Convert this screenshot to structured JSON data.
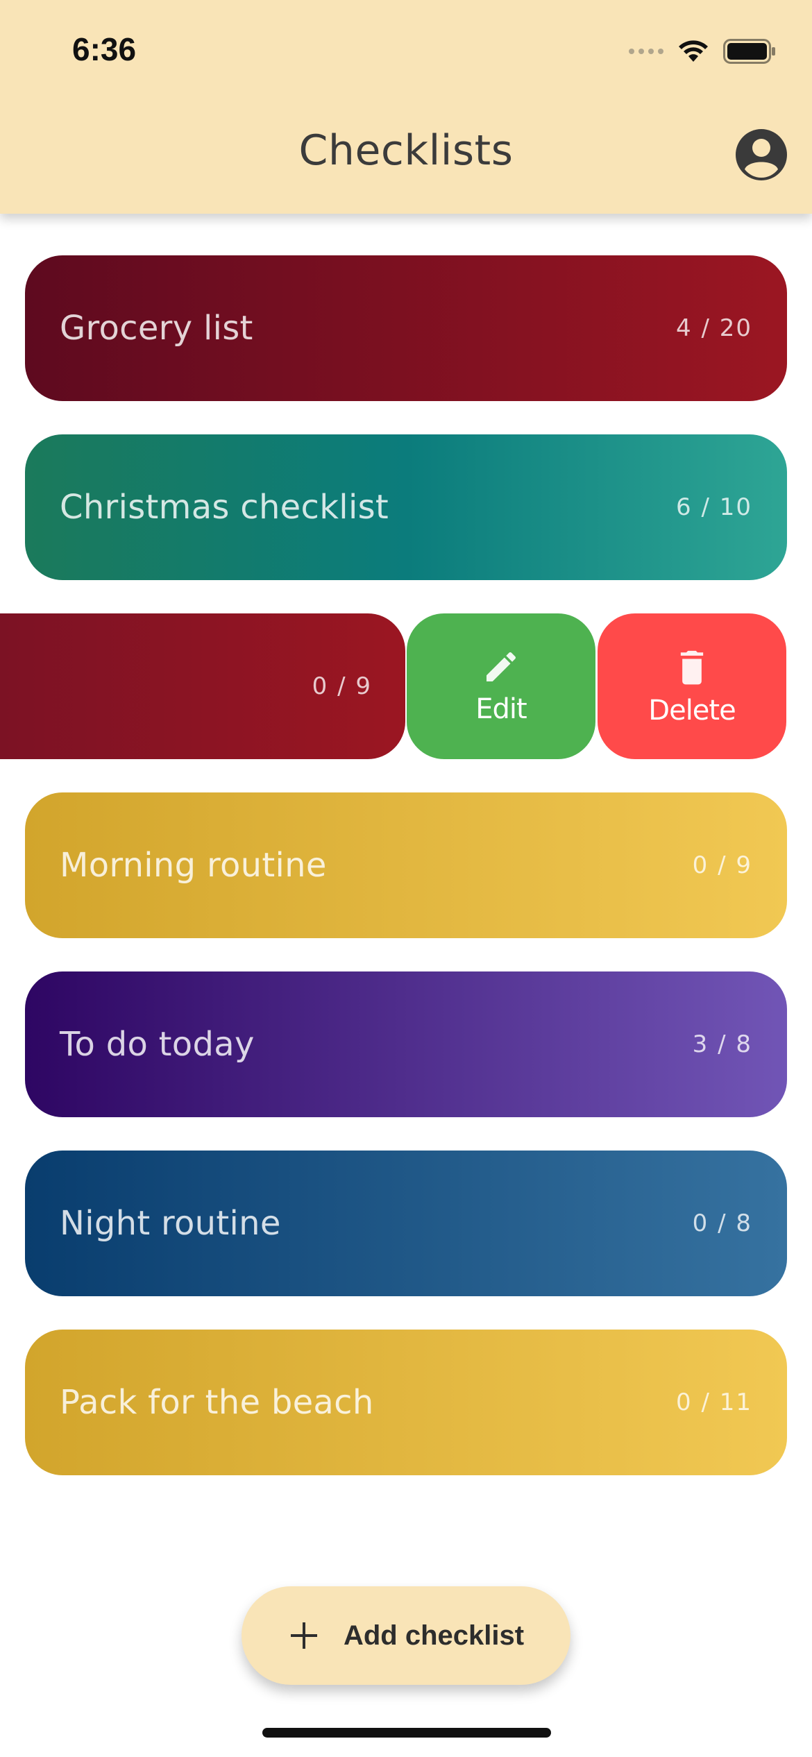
{
  "status_bar": {
    "time": "6:36"
  },
  "header": {
    "title": "Checklists",
    "profile_icon": "account-circle-icon"
  },
  "checklists": [
    {
      "title": "Grocery list",
      "count": "4 / 20",
      "gradient": [
        "#5e0a1f",
        "#9b1622"
      ]
    },
    {
      "title": "Christmas checklist",
      "count": "6 / 10",
      "gradient": [
        "#1b7a5b",
        "#0b7c7c",
        "#2ea595"
      ]
    },
    {
      "title": "Morning routine",
      "count": "0 / 9",
      "gradient": [
        "#d2a52c",
        "#f1c853"
      ]
    },
    {
      "title": "To do today",
      "count": "3 / 8",
      "gradient": [
        "#2e0663",
        "#7155b6"
      ]
    },
    {
      "title": "Night routine",
      "count": "0 / 8",
      "gradient": [
        "#093d6e",
        "#3672a0"
      ]
    },
    {
      "title": "Pack for the beach",
      "count": "0 / 11",
      "gradient": [
        "#d2a52c",
        "#f1c853"
      ]
    }
  ],
  "swiped_item": {
    "count": "0 / 9",
    "gradient": [
      "#7c1224",
      "#9b1622"
    ],
    "edit": {
      "label": "Edit",
      "icon": "pencil-icon",
      "color": "#4eb250"
    },
    "delete": {
      "label": "Delete",
      "icon": "trash-icon",
      "color": "#ff4a4a"
    }
  },
  "fab": {
    "label": "Add checklist",
    "icon": "plus-icon"
  }
}
